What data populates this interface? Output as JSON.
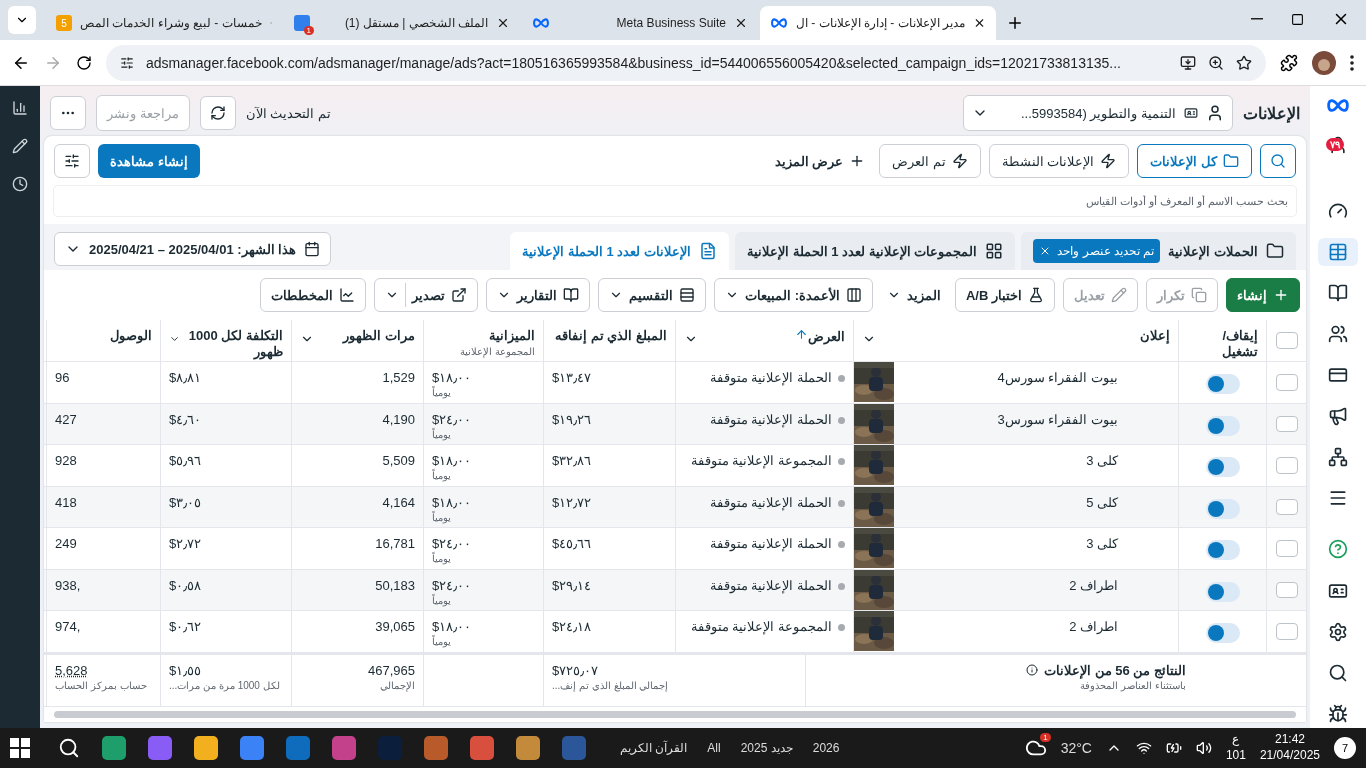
{
  "browser": {
    "tabs": [
      {
        "title": "مدير الإعلانات - إدارة الإعلانات - ال",
        "selected": true
      },
      {
        "title": "Meta Business Suite",
        "selected": false
      },
      {
        "title": "(1) الملف الشخصي | مستقل",
        "icon_badge": "1",
        "selected": false
      },
      {
        "title": "خمسات - لبيع وشراء الخدمات المص",
        "icon_text": "5",
        "selected": false
      }
    ],
    "url": "adsmanager.facebook.com/adsmanager/manage/ads?act=180516365993584&business_id=544006556005420&selected_campaign_ids=12021733813135..."
  },
  "nav": {
    "badge": "٧٩",
    "items": [
      {
        "selected": false
      },
      {
        "selected": true
      },
      {
        "selected": false
      },
      {
        "selected": false
      },
      {
        "selected": false
      },
      {
        "selected": false
      },
      {
        "selected": false
      },
      {
        "selected": false
      },
      {
        "selected": false
      },
      {
        "selected": false
      },
      {
        "selected": false
      },
      {
        "selected": false
      },
      {
        "selected": false
      }
    ]
  },
  "header": {
    "title": "الإعلانات",
    "account": "التنمية والتطوير (5993584...",
    "updated": "تم التحديث الآن",
    "review_button": {
      "label": "مراجعة ونشر",
      "disabled": true
    }
  },
  "filters": [
    {
      "label": "كل الإعلانات",
      "selected": true
    },
    {
      "label": "الإعلانات النشطة",
      "selected": false
    },
    {
      "label": "تم العرض",
      "selected": false
    }
  ],
  "show_more": "عرض المزيد",
  "create_view": "إنشاء مشاهدة",
  "search": {
    "placeholder": "بحث حسب الاسم أو المعرف أو أدوات القياس"
  },
  "levels": [
    {
      "label": "الحملات الإعلانية",
      "chip": "تم تحديد عنصر واحد",
      "selected": false
    },
    {
      "label": "المجموعات الإعلانية لعدد 1 الحملة الإعلانية",
      "selected": false
    },
    {
      "label": "الإعلانات لعدد 1 الحملة الإعلانية",
      "selected": true
    }
  ],
  "date_range": "هذا الشهر: 2025/04/01 – 2025/04/21",
  "toolbar": [
    {
      "kind": "primary",
      "label": "إنشاء",
      "disabled": false
    },
    {
      "kind": "button",
      "label": "تكرار",
      "disabled": true
    },
    {
      "kind": "button",
      "label": "تعديل",
      "disabled": true
    },
    {
      "kind": "button",
      "label": "اختبار A/B",
      "disabled": false
    },
    {
      "kind": "menu",
      "label": "المزيد",
      "disabled": false
    },
    {
      "kind": "dropdown",
      "label": "الأعمدة: المبيعات",
      "disabled": false
    },
    {
      "kind": "dropdown",
      "label": "التقسيم",
      "disabled": false
    },
    {
      "kind": "dropdown",
      "label": "التقارير",
      "disabled": false
    },
    {
      "kind": "split",
      "label": "تصدير",
      "disabled": false
    },
    {
      "kind": "button",
      "label": "المخططات",
      "disabled": false
    }
  ],
  "table": {
    "all_checked": false,
    "columns": [
      {
        "label": "إيقاف/تشغيل",
        "menu": false,
        "sorted": false
      },
      {
        "label": "إعلان",
        "menu": true,
        "sorted": false
      },
      {
        "label": "العرض",
        "menu": true,
        "sorted": true
      },
      {
        "label": "المبلغ الذي تم إنفاقه",
        "menu": false,
        "sorted": false
      },
      {
        "label": "الميزانية",
        "sub": "المجموعة الإعلانية",
        "menu": false,
        "sorted": false
      },
      {
        "label": "مرات الظهور",
        "menu": true,
        "sorted": false
      },
      {
        "label": "التكلفة لكل 1000 ظهور",
        "menu": true,
        "sorted": false
      },
      {
        "label": "الوصول",
        "menu": false,
        "sorted": false
      }
    ],
    "rows": [
      {
        "checked": false,
        "on": true,
        "name": "بيوت الفقراء سورس4",
        "delivery": "الحملة الإعلانية متوقفة",
        "spent": "١٣٫٤٧$",
        "budget": "١٨٫٠٠$",
        "budget_period": "يومياً",
        "impressions": "1,529",
        "cpm": "٨٫٨١$",
        "reach": "96"
      },
      {
        "checked": false,
        "on": true,
        "name": "بيوت الفقراء سورس3",
        "delivery": "الحملة الإعلانية متوقفة",
        "spent": "١٩٫٢٦$",
        "budget": "٢٤٫٠٠$",
        "budget_period": "يومياً",
        "impressions": "4,190",
        "cpm": "٤٫٦٠$",
        "reach": "427"
      },
      {
        "checked": false,
        "on": true,
        "name": "كلى 3",
        "delivery": "المجموعة الإعلانية متوقفة",
        "spent": "٣٢٫٨٦$",
        "budget": "١٨٫٠٠$",
        "budget_period": "يومياً",
        "impressions": "5,509",
        "cpm": "٥٫٩٦$",
        "reach": "928"
      },
      {
        "checked": false,
        "on": true,
        "name": "كلى 5",
        "delivery": "الحملة الإعلانية متوقفة",
        "spent": "١٢٫٧٢$",
        "budget": "١٨٫٠٠$",
        "budget_period": "يومياً",
        "impressions": "4,164",
        "cpm": "٣٫٠٥$",
        "reach": "418"
      },
      {
        "checked": false,
        "on": true,
        "name": "كلى 3",
        "delivery": "الحملة الإعلانية متوقفة",
        "spent": "٤٥٫٦٦$",
        "budget": "٢٤٫٠٠$",
        "budget_period": "يومياً",
        "impressions": "16,781",
        "cpm": "٢٫٧٢$",
        "reach": "249"
      },
      {
        "checked": false,
        "on": true,
        "name": "اطراف 2",
        "delivery": "الحملة الإعلانية متوقفة",
        "spent": "٢٩٫١٤$",
        "budget": "٢٤٫٠٠$",
        "budget_period": "يومياً",
        "impressions": "50,183",
        "cpm": "٠٫٥٨$",
        "reach": ",938"
      },
      {
        "checked": false,
        "on": true,
        "name": "اطراف 2",
        "delivery": "المجموعة الإعلانية متوقفة",
        "spent": "٢٤٫١٨$",
        "budget": "١٨٫٠٠$",
        "budget_period": "يومياً",
        "impressions": "39,065",
        "cpm": "٠٫٦٢$",
        "reach": ",974"
      }
    ],
    "totals": {
      "results": "النتائج من 56 من الإعلانات",
      "results_sub": "باستثناء العناصر المحذوفة",
      "spent": "٧٢٥٫٠٧$",
      "spent_sub": "إجمالي المبلغ الذي تم إنف...",
      "impressions": "467,965",
      "impressions_sub": "الإجمالي",
      "cpm": "١٫٥٥$",
      "cpm_sub": "لكل 1000 مرة من مرات...",
      "reach": "5,628",
      "reach_sub": "حساب بمركز الحساب"
    }
  },
  "taskbar": {
    "items": [
      "2026",
      "جديد 2025",
      "All",
      "القرآن الكريم"
    ],
    "weather": "32°C",
    "weather_badge": "1",
    "language": "ع",
    "language_sub": "101",
    "time": "21:42",
    "date": "21/04/2025",
    "notifications": "7"
  }
}
